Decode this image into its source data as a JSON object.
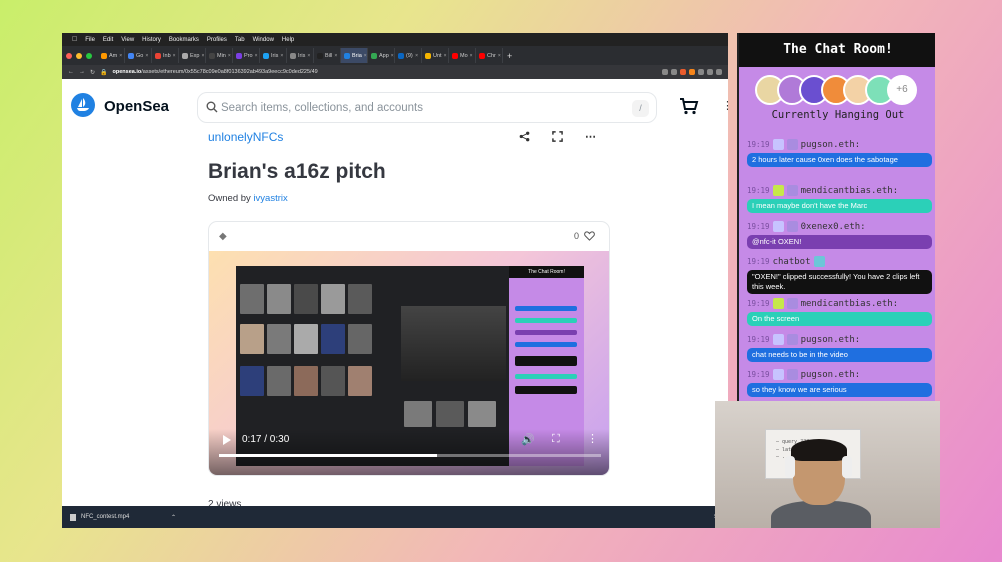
{
  "browser": {
    "menu": [
      "File",
      "Edit",
      "View",
      "History",
      "Bookmarks",
      "Profiles",
      "Tab",
      "Window",
      "Help"
    ],
    "tabs": [
      {
        "label": "Am",
        "color": "#ff9900"
      },
      {
        "label": "Go",
        "color": "#4285f4"
      },
      {
        "label": "Inb",
        "color": "#ea4335"
      },
      {
        "label": "Exp",
        "color": "#aaaaaa"
      },
      {
        "label": "Min",
        "color": "#444444"
      },
      {
        "label": "Pro",
        "color": "#7b3fe4"
      },
      {
        "label": "Iris",
        "color": "#1da1f2"
      },
      {
        "label": "Iris",
        "color": "#888888"
      },
      {
        "label": "Bill",
        "color": "#222222"
      },
      {
        "label": "Bria",
        "color": "#2081e2",
        "active": true
      },
      {
        "label": "App",
        "color": "#34a853"
      },
      {
        "label": "(9)",
        "color": "#0a66c2"
      },
      {
        "label": "Unt",
        "color": "#f4b400"
      },
      {
        "label": "Mo",
        "color": "#ff0000"
      },
      {
        "label": "Chr",
        "color": "#ff0000"
      }
    ],
    "url_host": "opensea.io",
    "url_path": "/assets/ethereum/0x55c78c09e0a8f0136392ab493a9eecc9c0ded225/49"
  },
  "opensea": {
    "brand": "OpenSea",
    "search_placeholder": "Search items, collections, and accounts",
    "search_shortcut": "/",
    "collection": "unlonelyNFCs",
    "title": "Brian's a16z pitch",
    "owned_prefix": "Owned by ",
    "owner": "ivyastrix",
    "likes": "0",
    "video_time": "0:17 / 0:30",
    "video_progress": 0.57,
    "views": "2 views"
  },
  "downloads": {
    "file": "NFC_contest.mp4",
    "right": "Sh"
  },
  "chat": {
    "title": "The Chat Room!",
    "more": "+6",
    "hanging": "Currently Hanging Out",
    "avatars": [
      "#e9d6a3",
      "#b07ad8",
      "#6a4fd0",
      "#f08c3a",
      "#f3d2a6",
      "#7de0b8"
    ],
    "messages": [
      {
        "time": "19:19",
        "user": "pugson.eth:",
        "text": "2 hours later cause 0xen does the sabotage",
        "color": "#1f6fe0",
        "badge": "#c7c3ff"
      },
      {
        "time": "19:19",
        "user": "mendicantbias.eth:",
        "text": "I mean maybe don't have the Marc",
        "color": "#2bd0b8",
        "badge": "#c6e84a"
      },
      {
        "time": "19:19",
        "user": "0xenex0.eth:",
        "text": "@nfc-it OXEN!",
        "color": "#7a3fb0",
        "badge": "#c7c3ff"
      },
      {
        "time": "19:19",
        "user": "chatbot",
        "text": "\"OXEN!\" clipped successfully! You have 2 clips left this week.",
        "color": "#111111",
        "badge": ""
      },
      {
        "time": "19:19",
        "user": "mendicantbias.eth:",
        "text": "On the screen",
        "color": "#2bd0b8",
        "badge": "#c6e84a"
      },
      {
        "time": "19:19",
        "user": "pugson.eth:",
        "text": "chat needs to be in the video",
        "color": "#1f6fe0",
        "badge": "#c7c3ff"
      },
      {
        "time": "19:19",
        "user": "pugson.eth:",
        "text": "so they know we are serious",
        "color": "#1f6fe0",
        "badge": "#c7c3ff"
      }
    ]
  },
  "webcam": {
    "board_text": "— query ???\n— latin\n— ..."
  }
}
